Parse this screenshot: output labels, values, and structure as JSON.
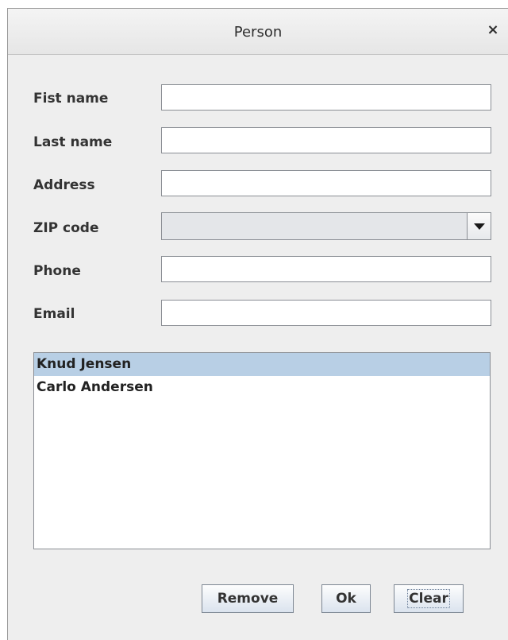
{
  "window": {
    "title": "Person",
    "close_glyph": "×"
  },
  "form": {
    "first_name": {
      "label": "Fist name",
      "value": ""
    },
    "last_name": {
      "label": "Last name",
      "value": ""
    },
    "address": {
      "label": "Address",
      "value": ""
    },
    "zip_code": {
      "label": "ZIP code",
      "value": ""
    },
    "phone": {
      "label": "Phone",
      "value": ""
    },
    "email": {
      "label": "Email",
      "value": ""
    }
  },
  "person_list": {
    "items": [
      {
        "label": "Knud Jensen",
        "selected": true
      },
      {
        "label": "Carlo Andersen",
        "selected": false
      }
    ]
  },
  "buttons": {
    "remove": "Remove",
    "ok": "Ok",
    "clear": "Clear"
  },
  "colors": {
    "selection": "#b8cfe5",
    "window_bg": "#eeeeee"
  }
}
